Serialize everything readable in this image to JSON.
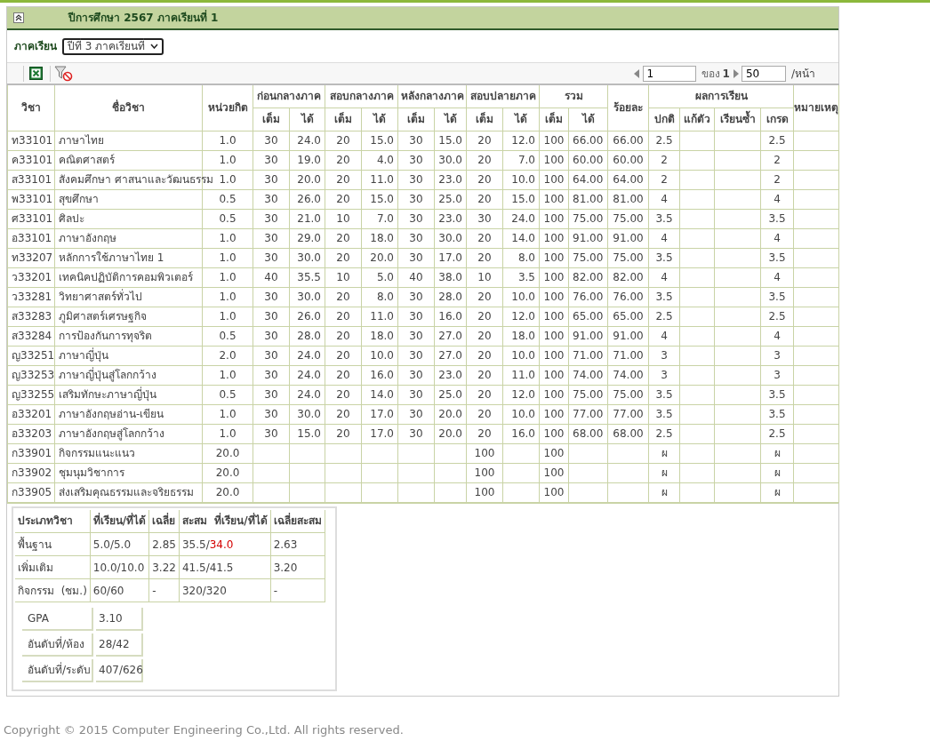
{
  "panel": {
    "title": "ปีการศึกษา 2567 ภาคเรียนที่ 1",
    "expanded": true
  },
  "filter": {
    "label": "ภาคเรียน",
    "value": "ปีที่ 3 ภาคเรียนที่"
  },
  "pager": {
    "page": "1",
    "of_label": "ของ",
    "total": "1",
    "per_page": "50",
    "per_page_label": "/หน้า"
  },
  "table": {
    "columns": [
      {
        "label": "วิชา"
      },
      {
        "label": "ชื่อวิชา"
      },
      {
        "label": "หน่วยกิต"
      },
      {
        "label": "ก่อนกลางภาค",
        "colspan": 2,
        "sub": [
          "เต็ม",
          "ได้"
        ]
      },
      {
        "label": "สอบกลางภาค",
        "colspan": 2,
        "sub": [
          "เต็ม",
          "ได้"
        ]
      },
      {
        "label": "หลังกลางภาค",
        "colspan": 2,
        "sub": [
          "เต็ม",
          "ได้"
        ]
      },
      {
        "label": "สอบปลายภาค",
        "colspan": 2,
        "sub": [
          "เต็ม",
          "ได้"
        ]
      },
      {
        "label": "รวม",
        "colspan": 2,
        "sub": [
          "เต็ม",
          "ได้"
        ]
      },
      {
        "label": "ร้อยละ"
      },
      {
        "label": "ผลการเรียน",
        "colspan": 4,
        "sub": [
          "ปกติ",
          "แก้ตัว",
          "เรียนซ้ำ",
          "เกรด"
        ]
      },
      {
        "label": "หมายเหตุ"
      }
    ],
    "rows": [
      [
        "ท33101",
        "ภาษาไทย",
        "1.0",
        "30",
        "24.0",
        "20",
        "15.0",
        "30",
        "15.0",
        "20",
        "12.0",
        "100",
        "66.00",
        "66.00",
        "2.5",
        null,
        null,
        "2.5",
        null
      ],
      [
        "ค33101",
        "คณิตศาสตร์",
        "1.0",
        "30",
        "19.0",
        "20",
        "4.0",
        "30",
        "30.0",
        "20",
        "7.0",
        "100",
        "60.00",
        "60.00",
        "2",
        null,
        null,
        "2",
        null
      ],
      [
        "ส33101",
        "สังคมศึกษา ศาสนาและวัฒนธรรม",
        "1.0",
        "30",
        "20.0",
        "20",
        "11.0",
        "30",
        "23.0",
        "20",
        "10.0",
        "100",
        "64.00",
        "64.00",
        "2",
        null,
        null,
        "2",
        null
      ],
      [
        "พ33101",
        "สุขศึกษา",
        "0.5",
        "30",
        "26.0",
        "20",
        "15.0",
        "30",
        "25.0",
        "20",
        "15.0",
        "100",
        "81.00",
        "81.00",
        "4",
        null,
        null,
        "4",
        null
      ],
      [
        "ศ33101",
        "ศิลปะ",
        "0.5",
        "30",
        "21.0",
        "10",
        "7.0",
        "30",
        "23.0",
        "30",
        "24.0",
        "100",
        "75.00",
        "75.00",
        "3.5",
        null,
        null,
        "3.5",
        null
      ],
      [
        "อ33101",
        "ภาษาอังกฤษ",
        "1.0",
        "30",
        "29.0",
        "20",
        "18.0",
        "30",
        "30.0",
        "20",
        "14.0",
        "100",
        "91.00",
        "91.00",
        "4",
        null,
        null,
        "4",
        null
      ],
      [
        "ท33207",
        "หลักการใช้ภาษาไทย 1",
        "1.0",
        "30",
        "30.0",
        "20",
        "20.0",
        "30",
        "17.0",
        "20",
        "8.0",
        "100",
        "75.00",
        "75.00",
        "3.5",
        null,
        null,
        "3.5",
        null
      ],
      [
        "ว33201",
        "เทคนิคปฏิบัติการคอมพิวเตอร์",
        "1.0",
        "40",
        "35.5",
        "10",
        "5.0",
        "40",
        "38.0",
        "10",
        "3.5",
        "100",
        "82.00",
        "82.00",
        "4",
        null,
        null,
        "4",
        null
      ],
      [
        "ว33281",
        "วิทยาศาสตร์ทั่วไป",
        "1.0",
        "30",
        "30.0",
        "20",
        "8.0",
        "30",
        "28.0",
        "20",
        "10.0",
        "100",
        "76.00",
        "76.00",
        "3.5",
        null,
        null,
        "3.5",
        null
      ],
      [
        "ส33283",
        "ภูมิศาสตร์เศรษฐกิจ",
        "1.0",
        "30",
        "26.0",
        "20",
        "11.0",
        "30",
        "16.0",
        "20",
        "12.0",
        "100",
        "65.00",
        "65.00",
        "2.5",
        null,
        null,
        "2.5",
        null
      ],
      [
        "ส33284",
        "การป้องกันการทุจริต",
        "0.5",
        "30",
        "28.0",
        "20",
        "18.0",
        "30",
        "27.0",
        "20",
        "18.0",
        "100",
        "91.00",
        "91.00",
        "4",
        null,
        null,
        "4",
        null
      ],
      [
        "ญ33251",
        "ภาษาญี่ปุ่น",
        "2.0",
        "30",
        "24.0",
        "20",
        "10.0",
        "30",
        "27.0",
        "20",
        "10.0",
        "100",
        "71.00",
        "71.00",
        "3",
        null,
        null,
        "3",
        null
      ],
      [
        "ญ33253",
        "ภาษาญี่ปุ่นสู่โลกกว้าง",
        "1.0",
        "30",
        "24.0",
        "20",
        "16.0",
        "30",
        "23.0",
        "20",
        "11.0",
        "100",
        "74.00",
        "74.00",
        "3",
        null,
        null,
        "3",
        null
      ],
      [
        "ญ33255",
        "เสริมทักษะภาษาญี่ปุ่น",
        "0.5",
        "30",
        "24.0",
        "20",
        "14.0",
        "30",
        "25.0",
        "20",
        "12.0",
        "100",
        "75.00",
        "75.00",
        "3.5",
        null,
        null,
        "3.5",
        null
      ],
      [
        "อ33201",
        "ภาษาอังกฤษอ่าน-เขียน",
        "1.0",
        "30",
        "30.0",
        "20",
        "17.0",
        "30",
        "20.0",
        "20",
        "10.0",
        "100",
        "77.00",
        "77.00",
        "3.5",
        null,
        null,
        "3.5",
        null
      ],
      [
        "อ33203",
        "ภาษาอังกฤษสู่โลกกว้าง",
        "1.0",
        "30",
        "15.0",
        "20",
        "17.0",
        "30",
        "20.0",
        "20",
        "16.0",
        "100",
        "68.00",
        "68.00",
        "2.5",
        null,
        null,
        "2.5",
        null
      ],
      [
        "ก33901",
        "กิจกรรมแนะแนว",
        "20.0",
        null,
        null,
        null,
        null,
        null,
        null,
        "100",
        null,
        "100",
        null,
        null,
        "ผ",
        null,
        null,
        "ผ",
        null
      ],
      [
        "ก33902",
        "ชุมนุมวิชาการ",
        "20.0",
        null,
        null,
        null,
        null,
        null,
        null,
        "100",
        null,
        "100",
        null,
        null,
        "ผ",
        null,
        null,
        "ผ",
        null
      ],
      [
        "ก33905",
        "ส่งเสริมคุณธรรมและจริยธรรม",
        "20.0",
        null,
        null,
        null,
        null,
        null,
        null,
        "100",
        null,
        "100",
        null,
        null,
        "ผ",
        null,
        null,
        "ผ",
        null
      ]
    ]
  },
  "summary": {
    "columns": [
      "ประเภทวิชา",
      "ที่เรียน/ที่ได้",
      "เฉลี่ย",
      "สะสม  ที่เรียน/ที่ได้",
      "เฉลี่ยสะสม"
    ],
    "rows": [
      [
        {
          "text": "พื้นฐาน"
        },
        {
          "text": "5.0/5.0"
        },
        {
          "text": "2.85"
        },
        {
          "text": "35.5/",
          "alert": "34.0"
        },
        {
          "text": "2.63"
        }
      ],
      [
        {
          "text": "เพิ่มเติม"
        },
        {
          "text": "10.0/10.0"
        },
        {
          "text": "3.22"
        },
        {
          "text": "41.5/41.5"
        },
        {
          "text": "3.20"
        }
      ],
      [
        {
          "text": "กิจกรรม  (ชม.)"
        },
        {
          "text": "60/60"
        },
        {
          "text": "-"
        },
        {
          "text": "320/320"
        },
        {
          "text": "-"
        }
      ]
    ],
    "stats": [
      {
        "label": "GPA",
        "value": "3.10"
      },
      {
        "label": "อันดับที่/ห้อง",
        "value": "28/42"
      },
      {
        "label": "อันดับที่/ระดับ",
        "value": "407/626"
      }
    ]
  },
  "footer": "Copyright © 2015 Computer Engineering Co.,Ltd. All rights reserved."
}
